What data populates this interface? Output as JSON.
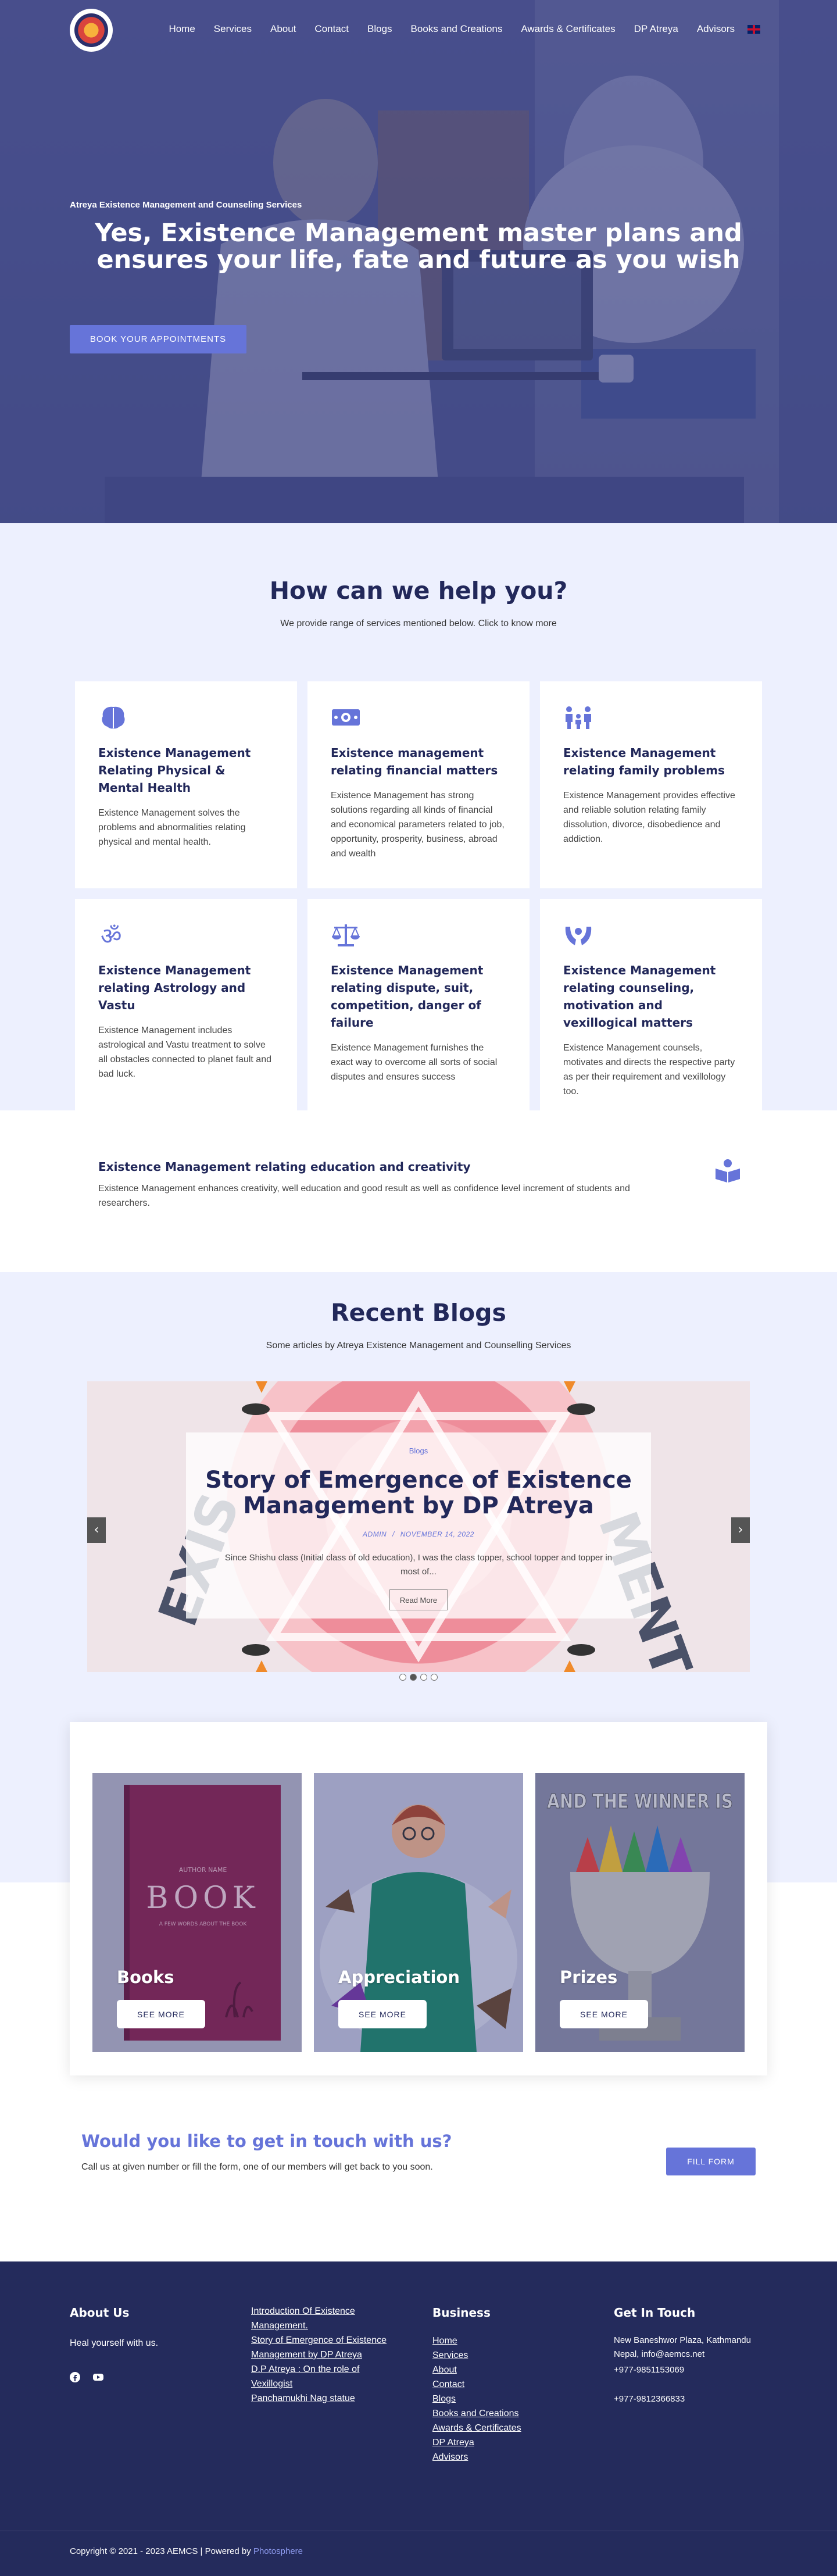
{
  "nav": {
    "items": [
      "Home",
      "Services",
      "About",
      "Contact",
      "Blogs",
      "Books and Creations",
      "Awards & Certificates",
      "DP Atreya",
      "Advisors"
    ]
  },
  "hero": {
    "eyebrow": "Atreya Existence Management and Counseling Services",
    "title": "Yes, Existence Management master plans and ensures your life, fate and future as you wish",
    "button": "BOOK YOUR APPOINTMENTS"
  },
  "services": {
    "title": "How can we help you?",
    "subtitle": "We provide range of services mentioned below. Click to know more",
    "cards": [
      {
        "icon": "brain-icon",
        "title": "Existence Management Relating Physical & Mental Health",
        "text": "Existence Management solves the problems and abnormalities relating physical and mental health."
      },
      {
        "icon": "money-icon",
        "title": "Existence management relating financial matters",
        "text": "Existence Management has strong solutions regarding all kinds of financial and economical parameters related to job, opportunity, prosperity, business, abroad and wealth"
      },
      {
        "icon": "family-icon",
        "title": "Existence Management relating family problems",
        "text": "Existence Management provides effective and reliable solution relating family dissolution, divorce, disobedience and addiction."
      },
      {
        "icon": "om-icon",
        "title": "Existence Management relating Astrology and Vastu",
        "text": "Existence Management includes astrological and Vastu treatment to solve all obstacles connected to planet fault and bad luck."
      },
      {
        "icon": "scale-icon",
        "title": "Existence Management relating dispute, suit, competition, danger of failure",
        "text": "Existence Management furnishes the exact way to overcome all sorts of social disputes and ensures success"
      },
      {
        "icon": "hands-icon",
        "title": "Existence Management relating counseling, motivation and vexillogical matters",
        "text": "Existence Management counsels, motivates and directs the respective party as per their requirement and vexillology too."
      },
      {
        "icon": "book-reader-icon",
        "title": "Existence Management relating education and creativity",
        "text": "Existence Management enhances creativity, well education and good result as well as confidence level increment of students and researchers."
      }
    ]
  },
  "blogs": {
    "title": "Recent Blogs",
    "subtitle": "Some articles by Atreya Existence Management and Counselling Services",
    "slide": {
      "category": "Blogs",
      "title": "Story of Emergence of Existence Management by DP Atreya",
      "author": "ADMIN",
      "separator": "/",
      "date": "NOVEMBER 14, 2022",
      "excerpt": "Since Shishu class (Initial class of old education), I was the class topper, school topper and topper in most of...",
      "read_more": "Read More"
    },
    "deco_text_left": "EXIS",
    "deco_text_right": "MENT",
    "slide_count": 4,
    "active_slide": 2
  },
  "gallery": {
    "tiles": [
      {
        "title": "Books",
        "button": "SEE MORE",
        "book_author": "AUTHOR NAME",
        "book_title": "BOOK",
        "book_subtitle": "A FEW WORDS ABOUT THE BOOK"
      },
      {
        "title": "Appreciation",
        "button": "SEE MORE"
      },
      {
        "title": "Prizes",
        "button": "SEE MORE",
        "trophy_text": "AND THE WINNER IS"
      }
    ]
  },
  "cta": {
    "title": "Would you like to get in touch with us?",
    "text": "Call us at given number or fill the form, one of our members will get back to you soon.",
    "button": "FILL FORM"
  },
  "footer": {
    "about_title": "About Us",
    "about_text": "Heal yourself with us.",
    "articles": [
      "Introduction Of Existence Management.",
      "Story of Emergence of Existence Management by DP Atreya",
      "D.P Atreya : On the role of Vexillogist",
      "Panchamukhi Nag statue"
    ],
    "business_title": "Business",
    "business_links": [
      "Home",
      "Services",
      "About",
      "Contact",
      "Blogs",
      "Books and Creations",
      "Awards & Certificates",
      "DP Atreya",
      "Advisors"
    ],
    "contact_title": "Get In Touch",
    "address": "New Baneshwor Plaza, Kathmandu Nepal, info@aemcs.net",
    "phone1": "+977-9851153069",
    "phone2": "+977-9812366833",
    "copyright": "Copyright © 2021 - 2023 AEMCS | Powered by",
    "powered_by": "Photosphere"
  },
  "colors": {
    "primary": "#6674d9",
    "navy": "#22285a",
    "footer": "#242b5c",
    "light_bg": "#edf0fe"
  }
}
